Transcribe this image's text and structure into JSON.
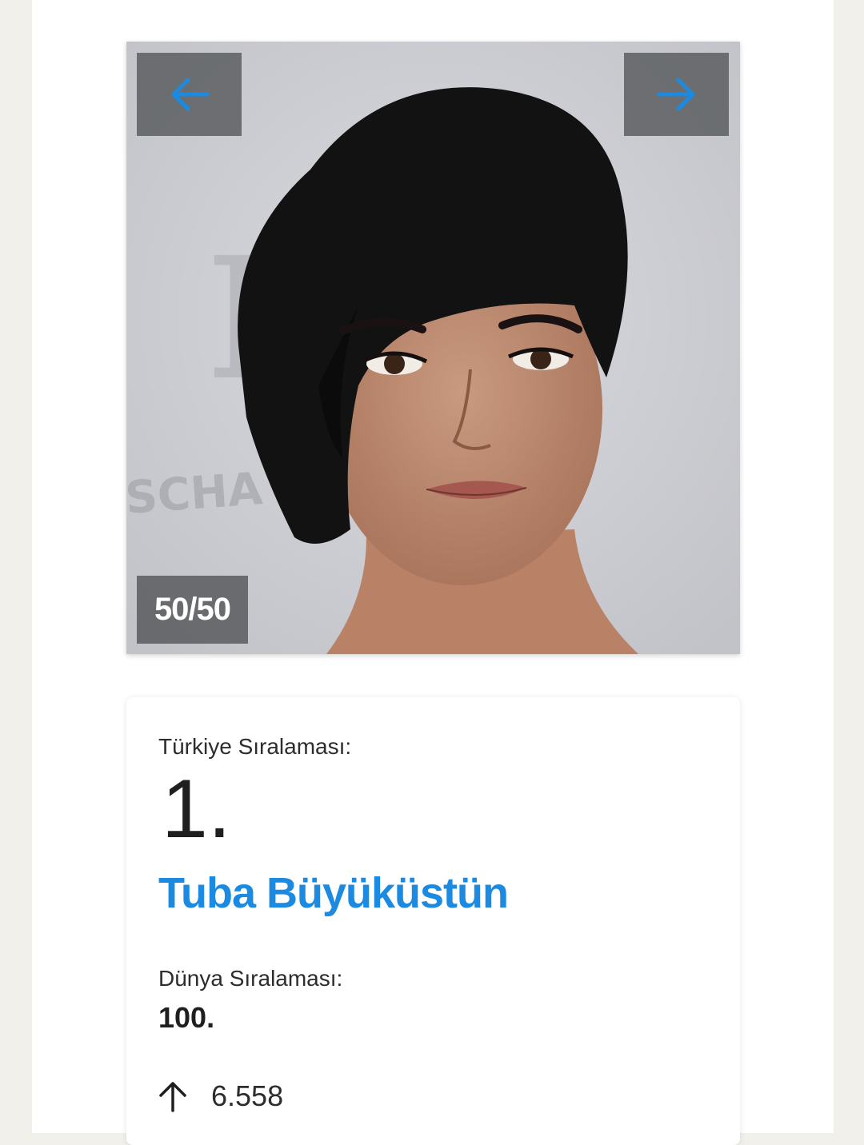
{
  "gallery": {
    "prev_icon": "arrow-left-icon",
    "next_icon": "arrow-right-icon",
    "counter": "50/50",
    "accent_color": "#1b8ae0",
    "background_text": "SCHA EN"
  },
  "ranking": {
    "turkey_label": "Türkiye Sıralaması:",
    "turkey_rank": "1.",
    "name": "Tuba Büyüküstün",
    "world_label": "Dünya Sıralaması:",
    "world_rank": "100.",
    "change_icon": "arrow-up-icon",
    "change_value": "6.558"
  }
}
